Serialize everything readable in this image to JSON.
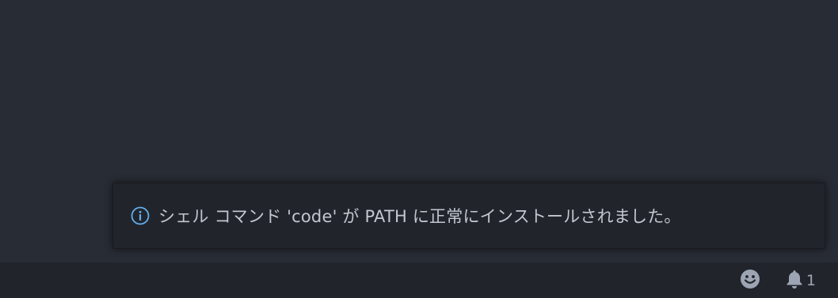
{
  "notification": {
    "icon": "info-icon",
    "message": "シェル コマンド 'code' が PATH に正常にインストールされました。"
  },
  "statusbar": {
    "feedback_icon": "smiley-icon",
    "notifications_icon": "bell-icon",
    "notification_count": "1"
  },
  "colors": {
    "editor_background": "#282c34",
    "statusbar_background": "#21252b",
    "info_accent": "#61afef",
    "text": "#c2c7d0"
  }
}
